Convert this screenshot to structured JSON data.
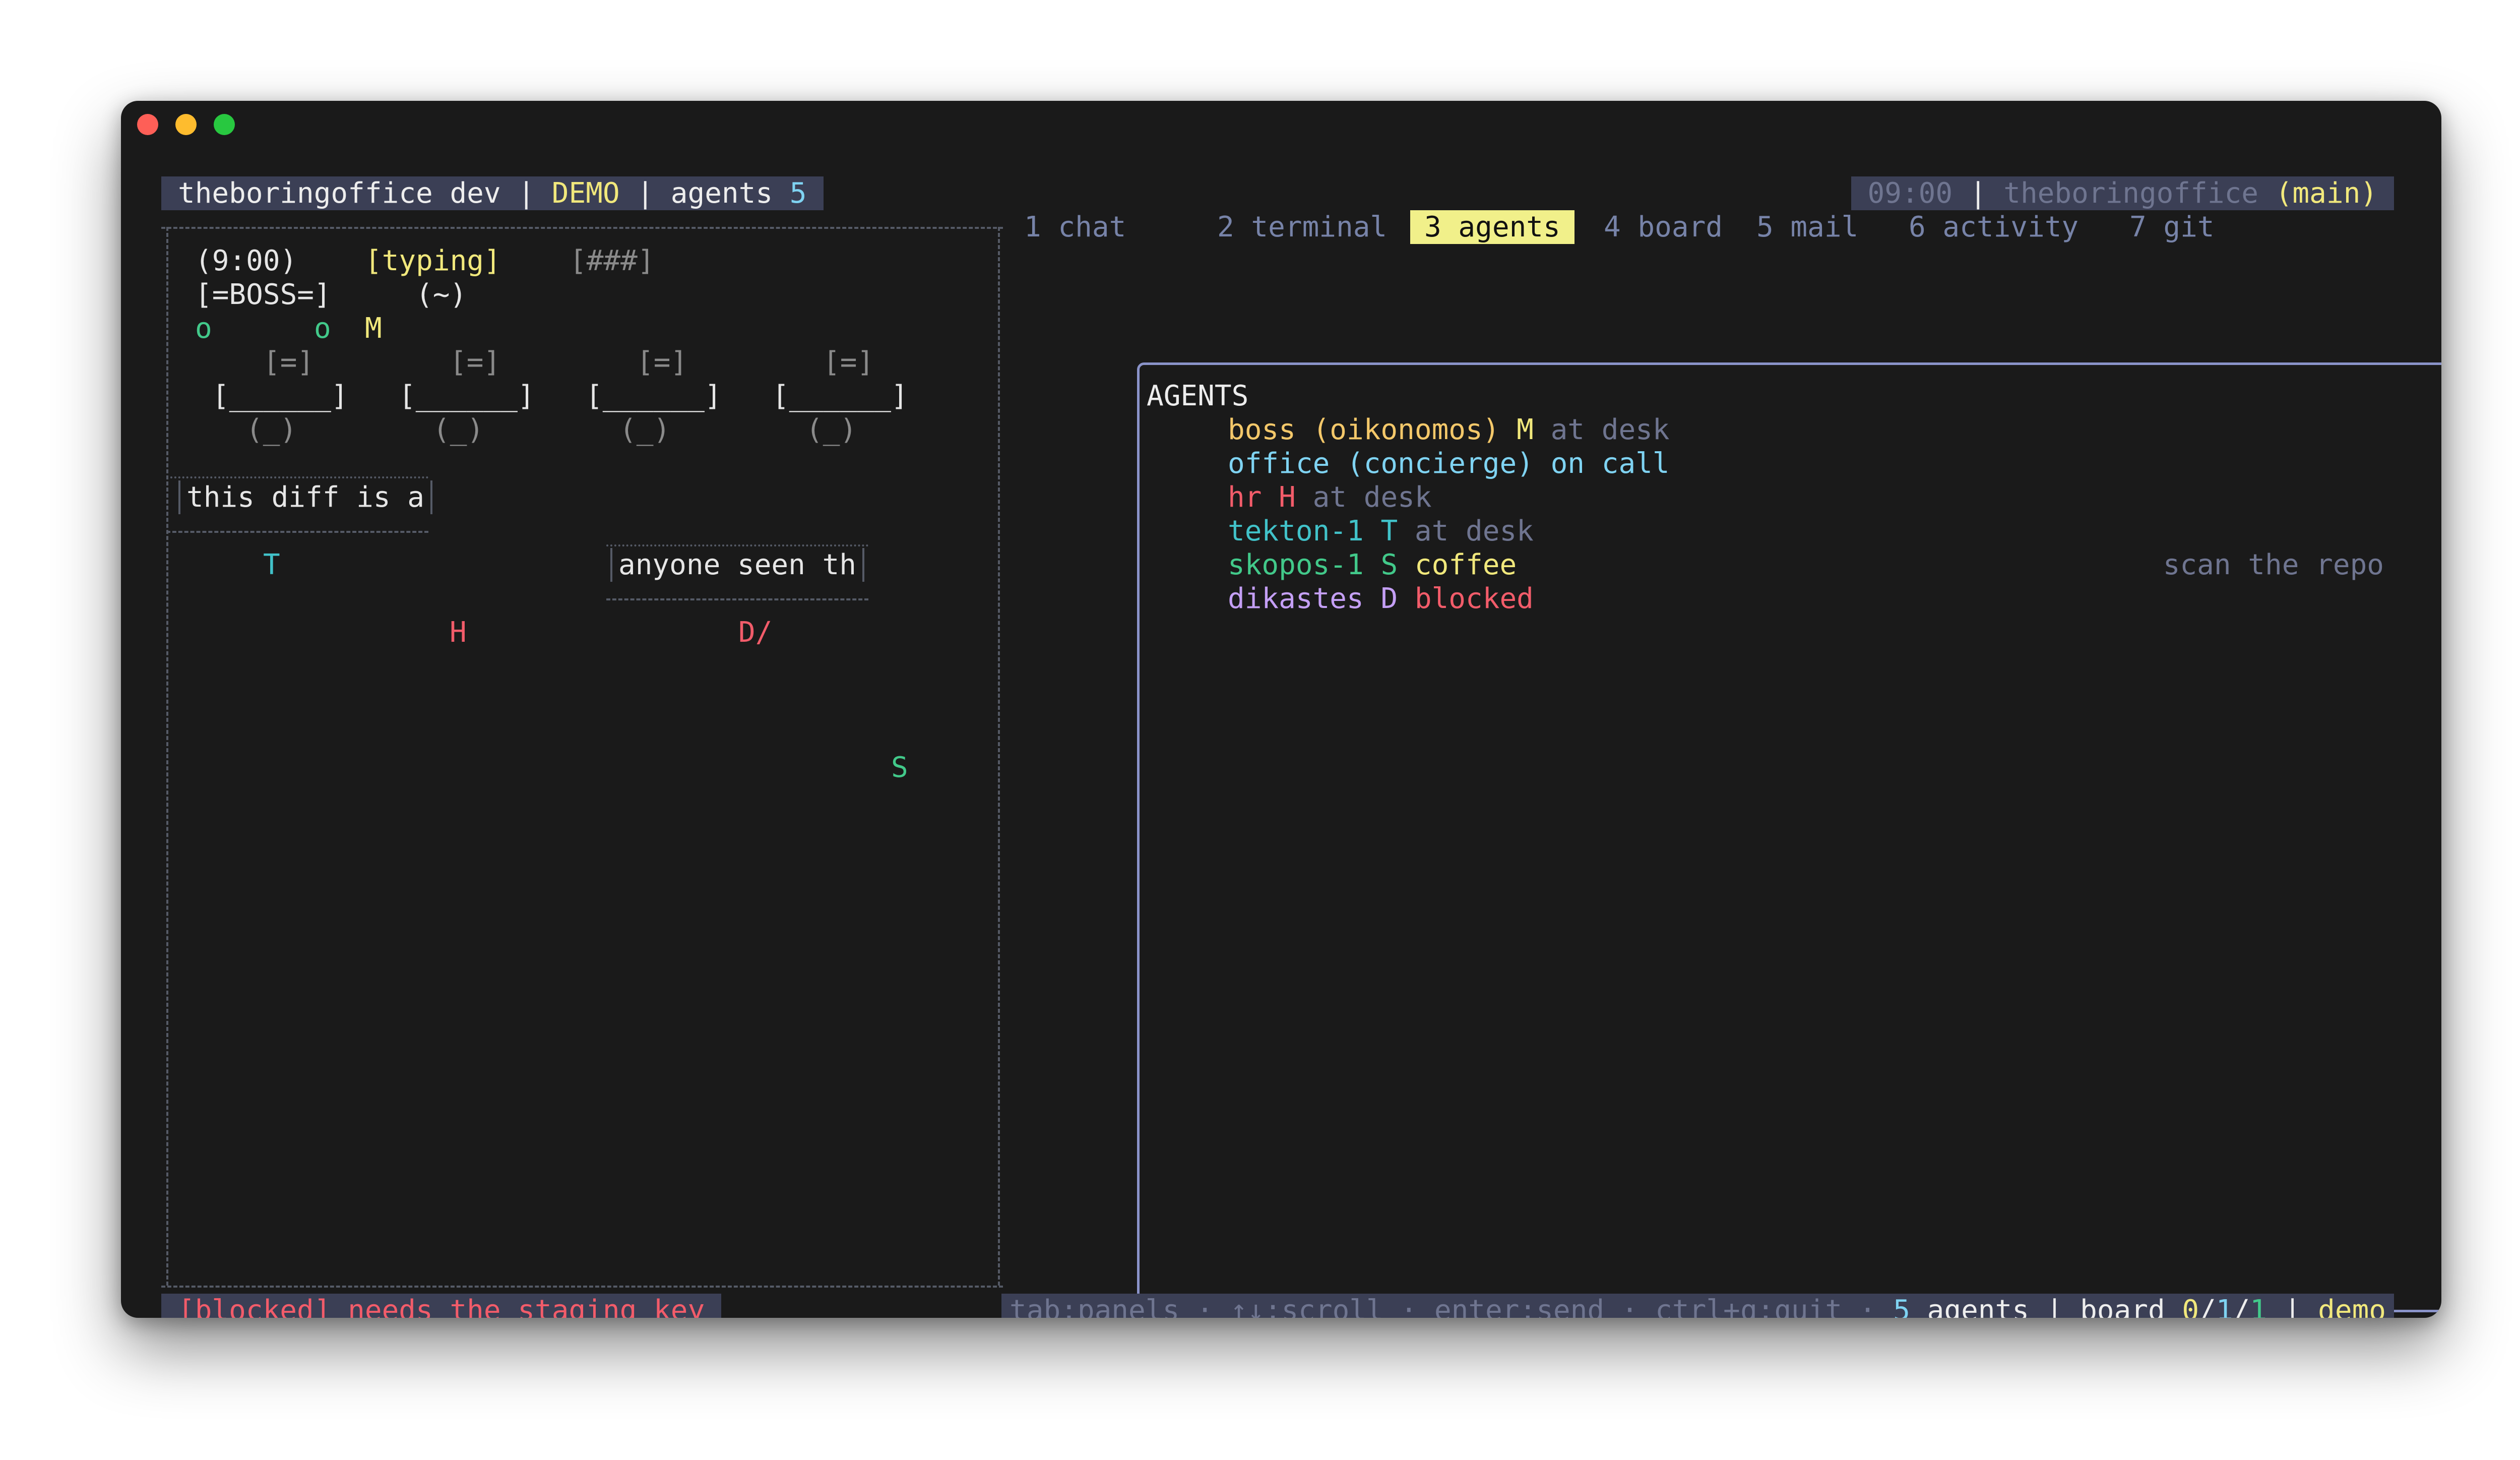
{
  "header": {
    "app": "theboringoffice dev",
    "sep1": "|",
    "mode": "DEMO",
    "sep2": "|",
    "agents_label": "agents",
    "agents_count": "5",
    "time": "09:00",
    "sep3": "|",
    "project": "theboringoffice",
    "branch": "(main)"
  },
  "tabs": [
    {
      "label": "1 chat"
    },
    {
      "label": "2 terminal"
    },
    {
      "label": "3 agents",
      "active": true
    },
    {
      "label": "4 board"
    },
    {
      "label": "5 mail"
    },
    {
      "label": "6 activity"
    },
    {
      "label": "7 git"
    }
  ],
  "office": {
    "clock": "(9:00)",
    "typing": "[typing]",
    "progress": "[###]",
    "boss_sign": "[=BOSS=]",
    "boss_face": "(~)",
    "chars_row": [
      "o",
      "o",
      "M"
    ],
    "monitor": "[=]",
    "desk": "[______]",
    "chair": "(_)",
    "bubble1": "this diff is a",
    "bubble2": "anyone seen th",
    "agent_t": "T",
    "agent_h": "H",
    "agent_d": "D/",
    "agent_s": "S"
  },
  "agents_panel": {
    "heading": "AGENTS",
    "rows": [
      {
        "name": "boss (oikonomos)",
        "glyph": "M",
        "status": "at desk"
      },
      {
        "name": "office (concierge)",
        "glyph": "",
        "status": "on call"
      },
      {
        "name": "hr",
        "glyph": "H",
        "status": "at desk"
      },
      {
        "name": "tekton-1",
        "glyph": "T",
        "status": "at desk"
      },
      {
        "name": "skopos-1",
        "glyph": "S",
        "status": "coffee",
        "note": "scan the repo"
      },
      {
        "name": "dikastes",
        "glyph": "D",
        "status": "blocked"
      }
    ]
  },
  "footer": {
    "alert": "[blocked] needs the staging key",
    "hints": "tab:panels · ↑↓:scroll · enter:send · ctrl+q:quit ·",
    "agents_count": "5",
    "agents_label": "agents",
    "sep1": "|",
    "board_label": "board",
    "board_a": "0",
    "board_slash1": "/",
    "board_b": "1",
    "board_slash2": "/",
    "board_c": "1",
    "sep2": "|",
    "mode": "demo"
  },
  "colors": {
    "background": "#1a1a1a",
    "bar": "#3b3f55",
    "accent_yellow": "#f1e87c",
    "accent_blue": "#7fd3f2",
    "active_tab": "#f1f08a",
    "blocked_red": "#f25c6a",
    "panel_border": "#8a93c9"
  }
}
